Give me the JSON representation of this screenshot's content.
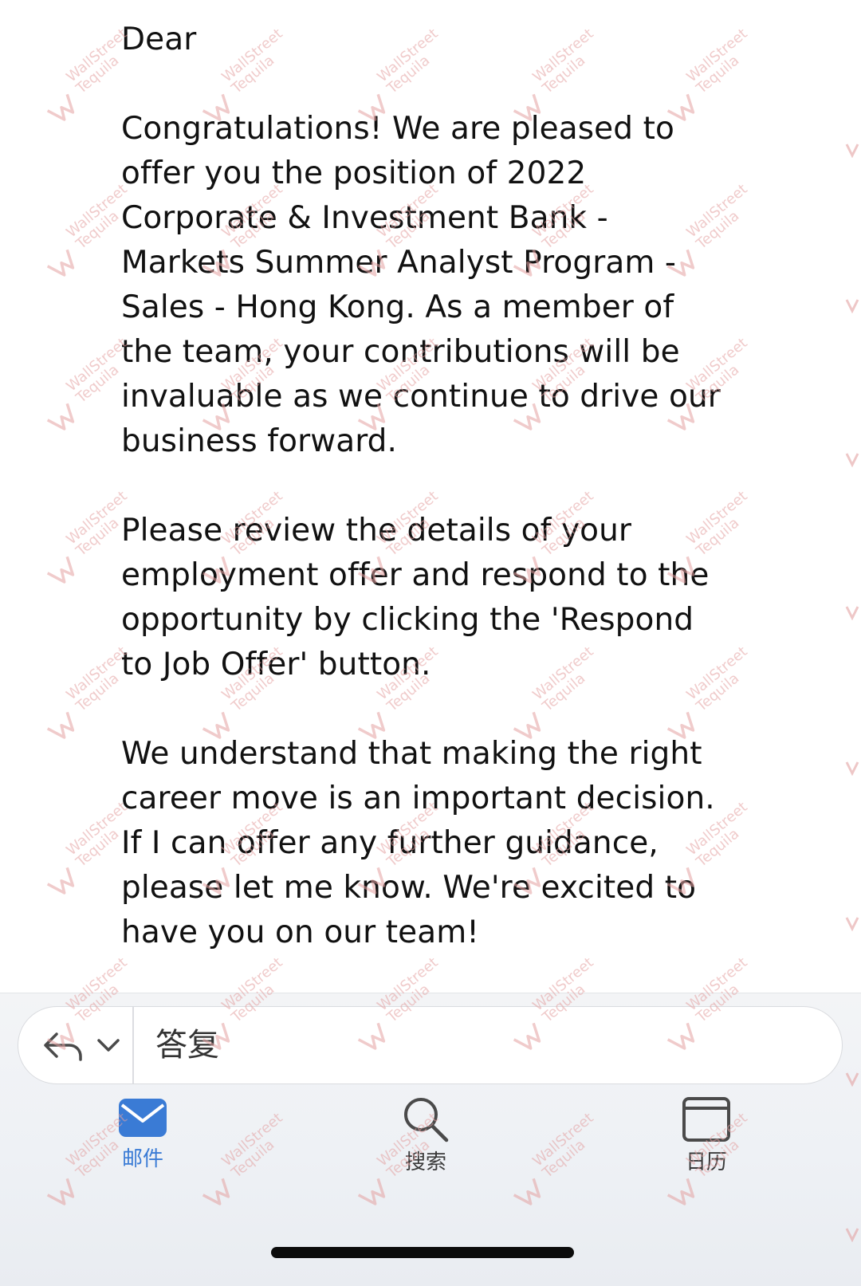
{
  "email": {
    "greeting": "Dear",
    "paragraphs": [
      "Congratulations! We are pleased to offer you the position of 2022 Corporate & Investment Bank - Markets Summer Analyst Program - Sales - Hong Kong. As a member of the team, your contributions will be invaluable as we continue to drive our business forward.",
      "Please review the details of your employment offer and respond to the opportunity by clicking the 'Respond to Job Offer' button.",
      "We understand that making the right career move is an important decision. If I can offer any further guidance, please let me know. We're excited to have you on our team!"
    ]
  },
  "reply_bar": {
    "label": "答复",
    "reply_icon": "reply-arrow-icon",
    "chevron_icon": "chevron-down-icon"
  },
  "tabs": [
    {
      "label": "邮件",
      "icon": "mail-icon",
      "active": true
    },
    {
      "label": "搜索",
      "icon": "search-icon",
      "active": false
    },
    {
      "label": "日历",
      "icon": "calendar-icon",
      "active": false
    }
  ],
  "watermark": {
    "text": "WallStreet\nTequila",
    "color": "#e4a2a2"
  },
  "colors": {
    "accent": "#3a7bd5",
    "text": "#111111"
  }
}
